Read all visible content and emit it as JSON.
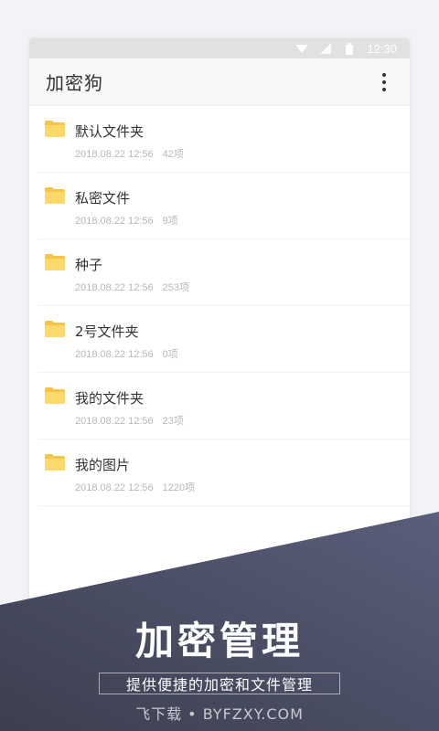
{
  "status_bar": {
    "time": "12:30",
    "icons": [
      "wifi-icon",
      "signal-icon",
      "battery-icon"
    ]
  },
  "app_bar": {
    "title": "加密狗",
    "menu_icon": "more-vertical-icon"
  },
  "folders": [
    {
      "name": "默认文件夹",
      "date": "2018.08.22 12:56",
      "count": "42项"
    },
    {
      "name": "私密文件",
      "date": "2018.08.22 12:56",
      "count": "9项"
    },
    {
      "name": "种子",
      "date": "2018.08.22 12:56",
      "count": "253项"
    },
    {
      "name": "2号文件夹",
      "date": "2018.08.22 12:56",
      "count": "0项"
    },
    {
      "name": "我的文件夹",
      "date": "2018.08.22 12:56",
      "count": "23项"
    },
    {
      "name": "我的图片",
      "date": "2018.08.22 12:56",
      "count": "1220项"
    }
  ],
  "promo": {
    "headline": "加密管理",
    "subline": "提供便捷的加密和文件管理",
    "watermark": "飞下载 • BYFZXY.COM"
  },
  "colors": {
    "folder": "#fdd86a",
    "folder_tab": "#f6c548",
    "band_start": "#3c3f4f",
    "band_end": "#5a5e7a"
  }
}
